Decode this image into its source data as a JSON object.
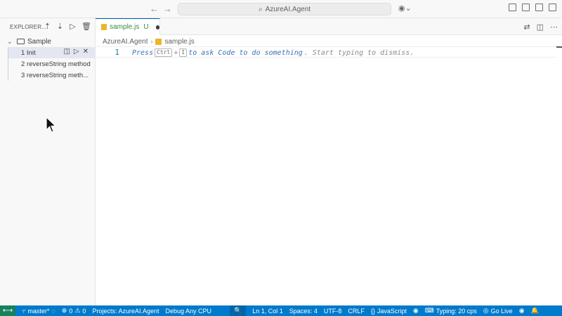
{
  "titlebar": {
    "search_text": "AzureAI.Agent",
    "back_icon": "arrow-left-icon",
    "forward_icon": "arrow-right-icon"
  },
  "sidebar": {
    "header": "EXPLORER...",
    "folder": "Sample",
    "items": [
      {
        "label": "1 Init"
      },
      {
        "label": "2 reverseString method"
      },
      {
        "label": "3 reverseString meth..."
      }
    ]
  },
  "tab": {
    "name": "sample.js",
    "status": "U"
  },
  "breadcrumb": {
    "root": "AzureAI.Agent",
    "file": "sample.js"
  },
  "editor": {
    "line_number": "1",
    "hint_press": "Press",
    "hint_key1": "Ctrl",
    "hint_plus": "+",
    "hint_key2": "I",
    "hint_mid": "to ask Code to do something",
    "hint_end": ". Start typing to dismiss."
  },
  "statusbar": {
    "branch": "master*",
    "errors": "0",
    "warnings": "0",
    "project": "Projects: AzureAI.Agent",
    "config": "Debug Any CPU",
    "position": "Ln 1, Col 1",
    "spaces": "Spaces: 4",
    "encoding": "UTF-8",
    "eol": "CRLF",
    "language": "JavaScript",
    "typing": "Typing: 20 cps",
    "golive": "Go Live"
  },
  "colors": {
    "accent": "#007acc",
    "remote": "#16825d",
    "js_icon": "#e8b729",
    "untracked": "#3b8a3b"
  }
}
